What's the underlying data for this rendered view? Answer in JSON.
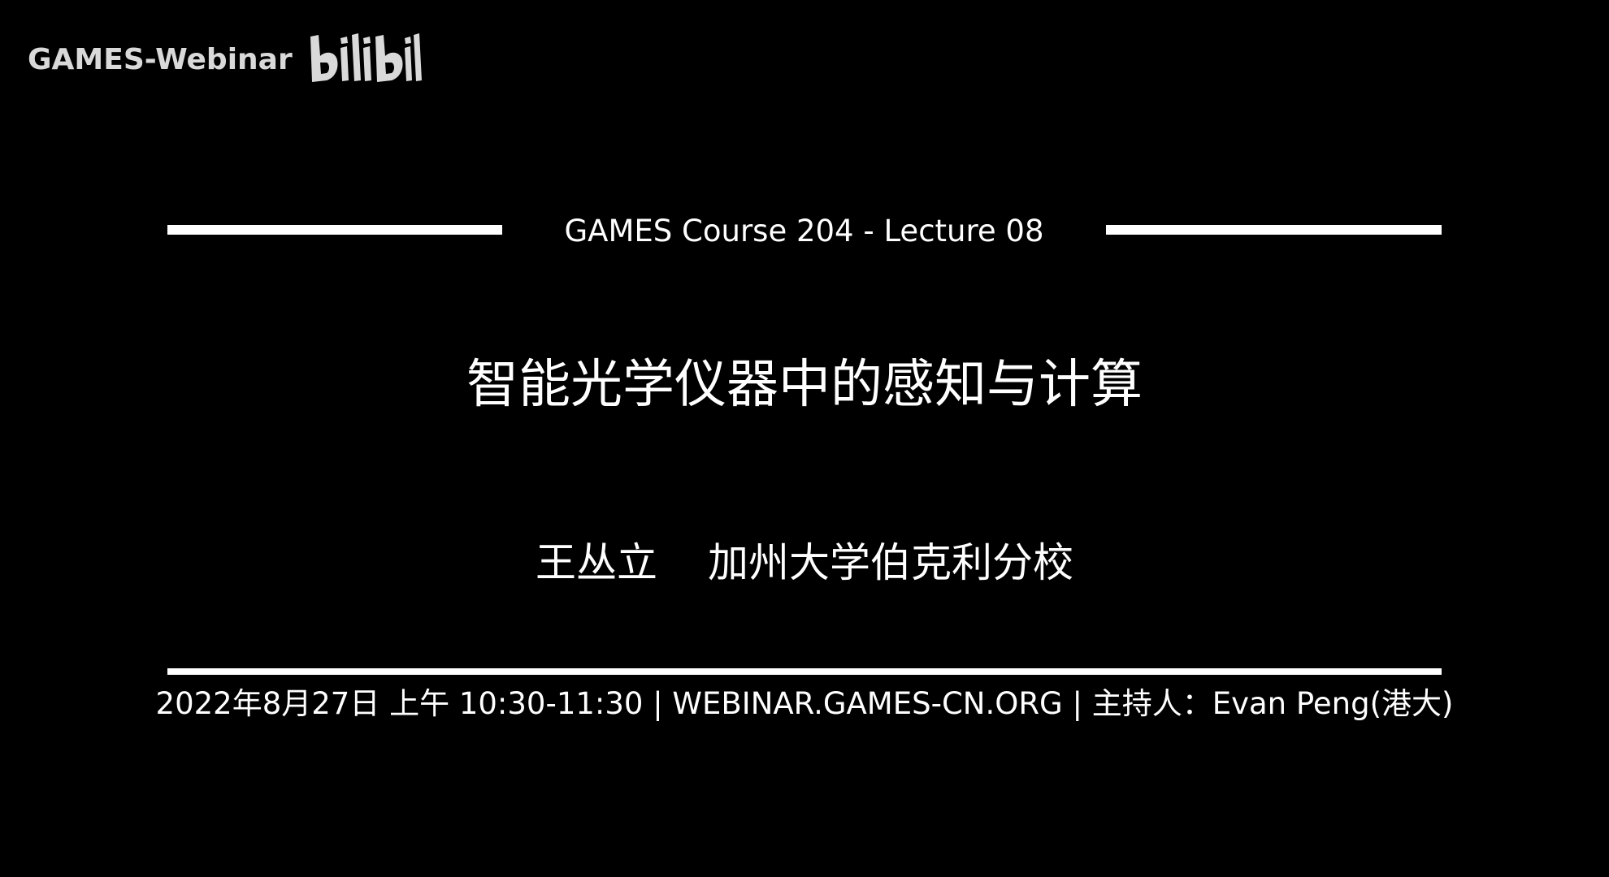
{
  "watermark": {
    "channel_label": "GAMES-Webinar",
    "logo_icon": "bilibili-logo-icon",
    "logo_text": "bilibili"
  },
  "slide": {
    "course": "GAMES Course 204 - Lecture 08",
    "title": "智能光学仪器中的感知与计算",
    "speaker_name": "王丛立",
    "speaker_affiliation": "加州大学伯克利分校",
    "footer": "2022年8月27日 上午 10:30-11:30 | WEBINAR.GAMES-CN.ORG | 主持人：Evan Peng(港大)"
  },
  "colors": {
    "background": "#000000",
    "foreground": "#ffffff",
    "watermark": "#d9d9d9"
  }
}
